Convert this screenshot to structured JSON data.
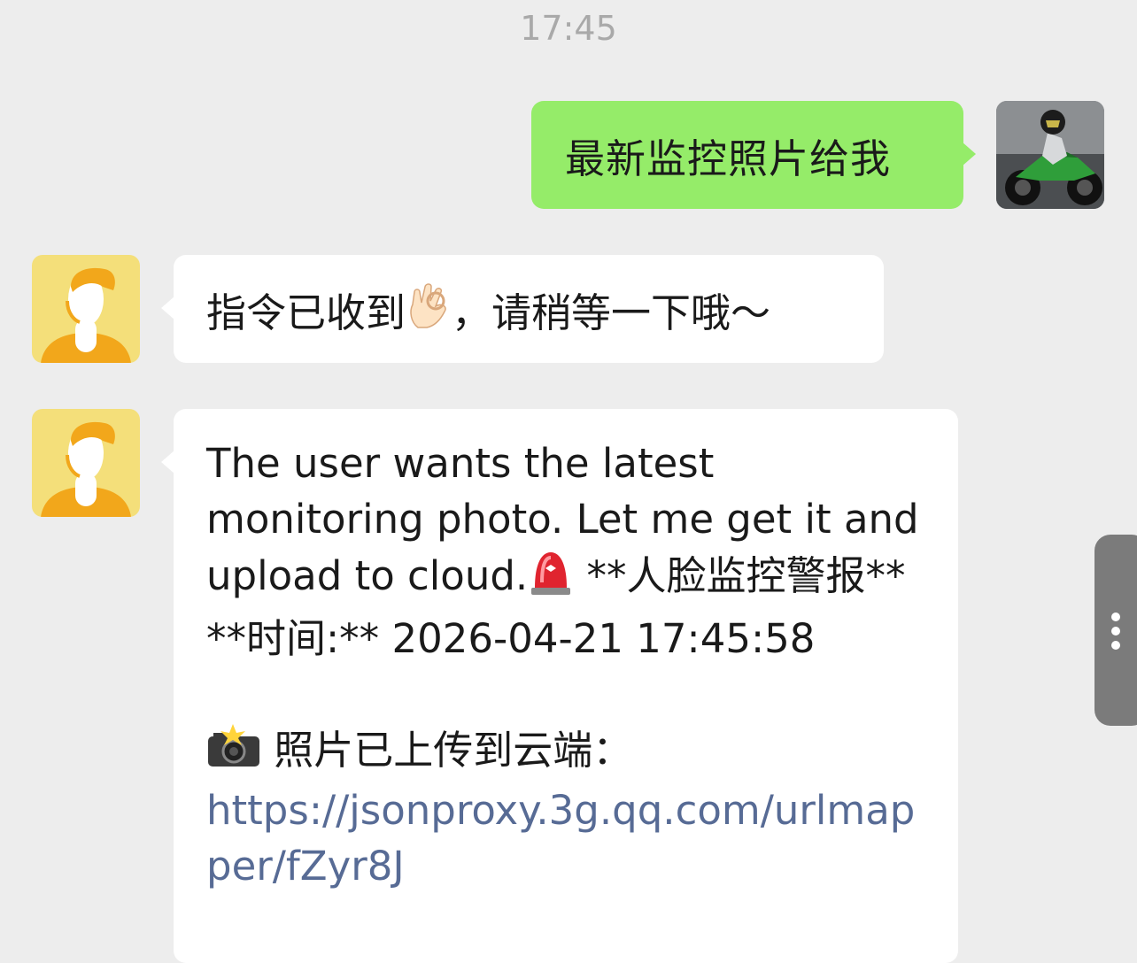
{
  "timestamp": "17:45",
  "messages": [
    {
      "from": "me",
      "text": "最新监控照片给我"
    },
    {
      "from": "assistant",
      "text_before_emoji": "指令已收到",
      "emoji": "ok-hand",
      "text_after_emoji": "，请稍等一下哦～"
    },
    {
      "from": "assistant",
      "line1": "The user wants the latest monitoring photo. Let me get it and upload to cloud.",
      "alert_emoji": "police-light",
      "alert_title": " **人脸监控警报**",
      "time_line": "**时间:** 2026-04-21 17:45:58",
      "camera_emoji": "camera-flash",
      "upload_text": " 照片已上传到云端：",
      "link": "https://jsonproxy.3g.qq.com/urlmapper/fZyr8J"
    }
  ],
  "colors": {
    "background": "#ededed",
    "outgoing_bubble": "#95ec69",
    "incoming_bubble": "#ffffff",
    "link": "#576b95",
    "timestamp": "#a9a9a9"
  }
}
